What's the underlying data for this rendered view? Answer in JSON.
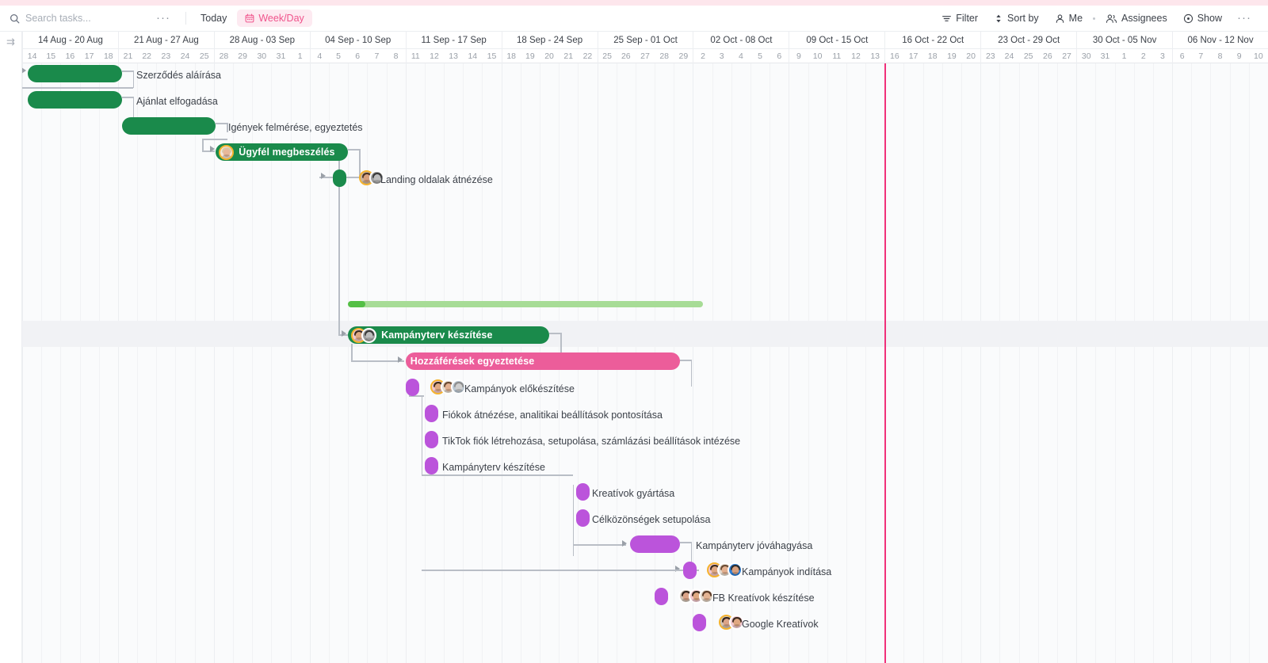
{
  "toolbar": {
    "search_placeholder": "Search tasks...",
    "search_value": "",
    "more_dots": "···",
    "today_label": "Today",
    "view_label": "Week/Day",
    "filter_label": "Filter",
    "sort_label": "Sort by",
    "me_label": "Me",
    "assignees_label": "Assignees",
    "show_label": "Show",
    "right_dots": "···",
    "accent_pink": "#f0548c",
    "chip_bg": "#fdeaf1"
  },
  "timeline": {
    "weeks": [
      {
        "label": "14 Aug - 20 Aug",
        "days": [
          "14",
          "15",
          "16",
          "17",
          "18"
        ]
      },
      {
        "label": "21 Aug - 27 Aug",
        "days": [
          "21",
          "22",
          "23",
          "24",
          "25"
        ]
      },
      {
        "label": "28 Aug - 03 Sep",
        "days": [
          "28",
          "29",
          "30",
          "31",
          "1"
        ]
      },
      {
        "label": "04 Sep - 10 Sep",
        "days": [
          "4",
          "5",
          "6",
          "7",
          "8"
        ]
      },
      {
        "label": "11 Sep - 17 Sep",
        "days": [
          "11",
          "12",
          "13",
          "14",
          "15"
        ]
      },
      {
        "label": "18 Sep - 24 Sep",
        "days": [
          "18",
          "19",
          "20",
          "21",
          "22"
        ]
      },
      {
        "label": "25 Sep - 01 Oct",
        "days": [
          "25",
          "26",
          "27",
          "28",
          "29"
        ]
      },
      {
        "label": "02 Oct - 08 Oct",
        "days": [
          "2",
          "3",
          "4",
          "5",
          "6"
        ]
      },
      {
        "label": "09 Oct - 15 Oct",
        "days": [
          "9",
          "10",
          "11",
          "12",
          "13"
        ]
      },
      {
        "label": "16 Oct - 22 Oct",
        "days": [
          "16",
          "17",
          "18",
          "19",
          "20"
        ]
      },
      {
        "label": "23 Oct - 29 Oct",
        "days": [
          "23",
          "24",
          "25",
          "26",
          "27"
        ]
      },
      {
        "label": "30 Oct - 05 Nov",
        "days": [
          "30",
          "31",
          "1",
          "2",
          "3"
        ]
      },
      {
        "label": "06 Nov - 12 Nov",
        "days": [
          "6",
          "7",
          "8",
          "9",
          "10"
        ]
      }
    ],
    "today_marker_color": "#f0307a",
    "today_after_day_index": 44
  },
  "tasks": [
    {
      "name": "Szerződés aláírása",
      "color": "green",
      "label_inside": false,
      "avatars": []
    },
    {
      "name": "Ajánlat elfogadása",
      "color": "green",
      "label_inside": false,
      "avatars": []
    },
    {
      "name": "Igények felmérése, egyeztetés",
      "color": "green",
      "label_inside": false,
      "avatars": []
    },
    {
      "name": "Ügyfél megbeszélés",
      "color": "green",
      "label_inside": true,
      "avatars": [
        "a1"
      ]
    },
    {
      "name": "Landing oldalak átnézése",
      "color": "green",
      "label_inside": false,
      "avatars": [
        "a2",
        "a3"
      ]
    },
    {
      "name": "Kampányterv készítése",
      "color": "green",
      "label_inside": true,
      "avatars": [
        "a4",
        "a3"
      ]
    },
    {
      "name": "Hozzáférések egyeztetése",
      "color": "pink",
      "label_inside": true,
      "avatars": []
    },
    {
      "name": "Kampányok előkészítése",
      "color": "purple",
      "label_inside": false,
      "avatars": [
        "a4",
        "a5",
        "a6"
      ]
    },
    {
      "name": "Fiókok átnézése, analitikai beállítások pontosítása",
      "color": "purple",
      "label_inside": false,
      "avatars": []
    },
    {
      "name": "TikTok fiók létrehozása, setupolása, számlázási beállítások intézése",
      "color": "purple",
      "label_inside": false,
      "avatars": []
    },
    {
      "name": "Kampányterv készítése",
      "color": "purple",
      "label_inside": false,
      "avatars": []
    },
    {
      "name": "Kreatívok gyártása",
      "color": "purple",
      "label_inside": false,
      "avatars": []
    },
    {
      "name": "Célközönségek setupolása",
      "color": "purple",
      "label_inside": false,
      "avatars": []
    },
    {
      "name": "Kampányterv jóváhagyása",
      "color": "purple",
      "label_inside": false,
      "avatars": []
    },
    {
      "name": "Kampányok indítása",
      "color": "purple",
      "label_inside": false,
      "avatars": [
        "a4",
        "a5",
        "a7"
      ]
    },
    {
      "name": "FB Kreatívok készítése",
      "color": "purple",
      "label_inside": false,
      "avatars": [
        "a8",
        "a4",
        "a9"
      ]
    },
    {
      "name": "Google Kreatívok",
      "color": "purple",
      "label_inside": false,
      "avatars": [
        "a8",
        "a4"
      ]
    }
  ],
  "colors": {
    "green": "#1a8a4b",
    "pink": "#ec5d9a",
    "purple": "#bb54db",
    "progress_track": "#a7dc96",
    "progress_fill": "#54bf45",
    "grid": "#eceef1",
    "weekend": "#f3f4f6"
  },
  "icons": {
    "search": "search-icon",
    "calendar": "calendar-icon",
    "filter": "filter-icon",
    "sort": "sort-icon",
    "me": "user-icon",
    "assignees": "users-icon",
    "show": "eye-icon",
    "expand": "expand-icon"
  }
}
